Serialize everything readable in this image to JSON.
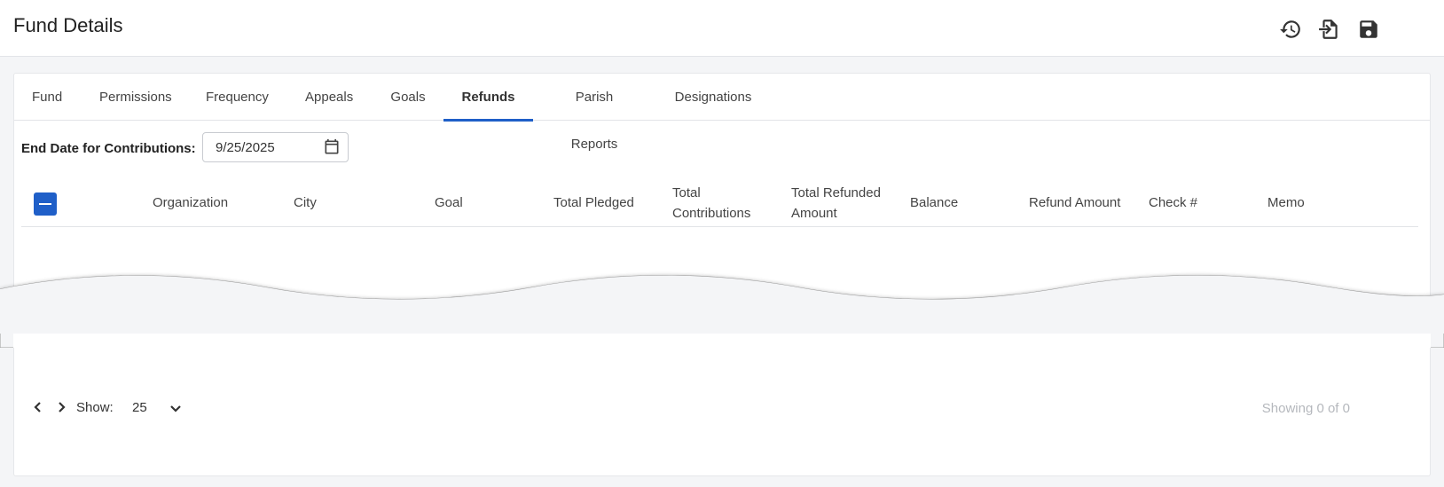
{
  "header": {
    "title": "Fund Details",
    "actions": [
      "history-icon",
      "export-icon",
      "save-icon"
    ]
  },
  "tabs": [
    {
      "label": "Fund",
      "active": false
    },
    {
      "label": "Permissions",
      "active": false
    },
    {
      "label": "Frequency",
      "active": false
    },
    {
      "label": "Appeals",
      "active": false
    },
    {
      "label": "Goals",
      "active": false
    },
    {
      "label": "Refunds",
      "active": true
    },
    {
      "label": "Parish Reports",
      "active": false
    },
    {
      "label": "Designations",
      "active": false
    }
  ],
  "filter": {
    "end_date_label": "End Date for Contributions:",
    "end_date_value": "9/25/2025"
  },
  "table": {
    "columns": [
      {
        "line1": "Organization",
        "line2": ""
      },
      {
        "line1": "City",
        "line2": ""
      },
      {
        "line1": "Goal",
        "line2": ""
      },
      {
        "line1": "Total Pledged",
        "line2": ""
      },
      {
        "line1": "Total",
        "line2": "Contributions"
      },
      {
        "line1": "Total Refunded",
        "line2": "Amount"
      },
      {
        "line1": "Balance",
        "line2": ""
      },
      {
        "line1": "Refund Amount",
        "line2": ""
      },
      {
        "line1": "Check #",
        "line2": ""
      },
      {
        "line1": "Memo",
        "line2": ""
      }
    ],
    "rows": []
  },
  "pager": {
    "show_label": "Show:",
    "page_size": "25",
    "summary": "Showing 0 of 0"
  },
  "colors": {
    "accent": "#1f5fc8",
    "muted_text": "#b5b8bd"
  }
}
